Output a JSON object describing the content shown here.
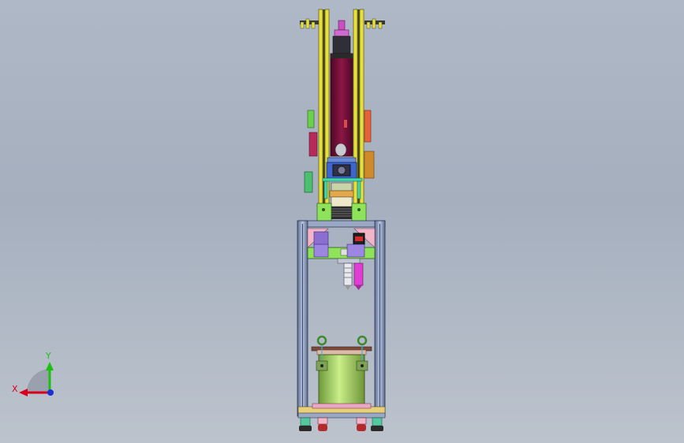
{
  "viewport": {
    "background_top": "#aeb8c6",
    "background_bottom": "#bcc3cd"
  },
  "triad": {
    "x_label": "X",
    "y_label": "Y",
    "x_color": "#d9001b",
    "y_color": "#19c20f",
    "z_color": "#1a2fd8"
  },
  "colors": {
    "frame_yellow": "#e8e03a",
    "frame_steel": "#8c9bb8",
    "cylinder_maroon": "#7a0f3a",
    "plate_green": "#8fe35a",
    "bracket_pink": "#f0b6c8",
    "bracket_purple": "#8a6fd0",
    "magenta": "#e23cd6",
    "tank_green": "#a9d86a"
  }
}
